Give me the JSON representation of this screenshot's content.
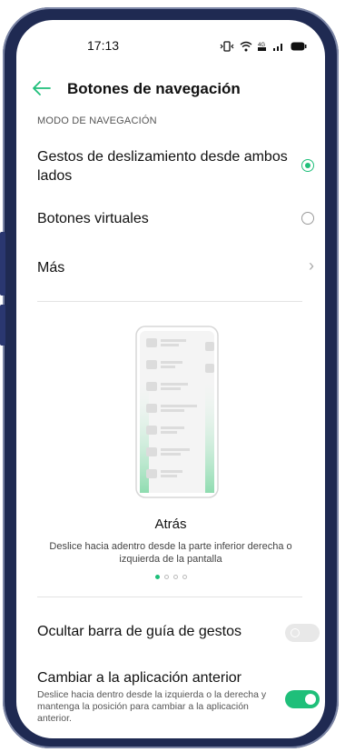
{
  "status_bar": {
    "time": "17:13"
  },
  "header": {
    "title": "Botones de navegación"
  },
  "section": {
    "label": "MODO DE NAVEGACIÓN"
  },
  "options": [
    {
      "label": "Gestos de deslizamiento desde ambos lados",
      "selected": true
    },
    {
      "label": "Botones virtuales",
      "selected": false
    }
  ],
  "more": {
    "label": "Más"
  },
  "illustration": {
    "title": "Atrás",
    "description": "Deslice hacia adentro desde la parte inferior derecha o izquierda de la pantalla",
    "page_count": 4,
    "active_page": 1
  },
  "settings": [
    {
      "label": "Ocultar barra de guía de gestos",
      "enabled": false
    },
    {
      "label": "Cambiar a la aplicación anterior",
      "description": "Deslice hacia dentro desde la izquierda o la derecha y mantenga la posición para cambiar a la aplicación anterior.",
      "enabled": true
    }
  ],
  "colors": {
    "accent": "#1fbf7a",
    "frame": "#1f2a52"
  },
  "icons": {
    "back": "arrow-left-icon",
    "chevron": "chevron-right-icon"
  }
}
